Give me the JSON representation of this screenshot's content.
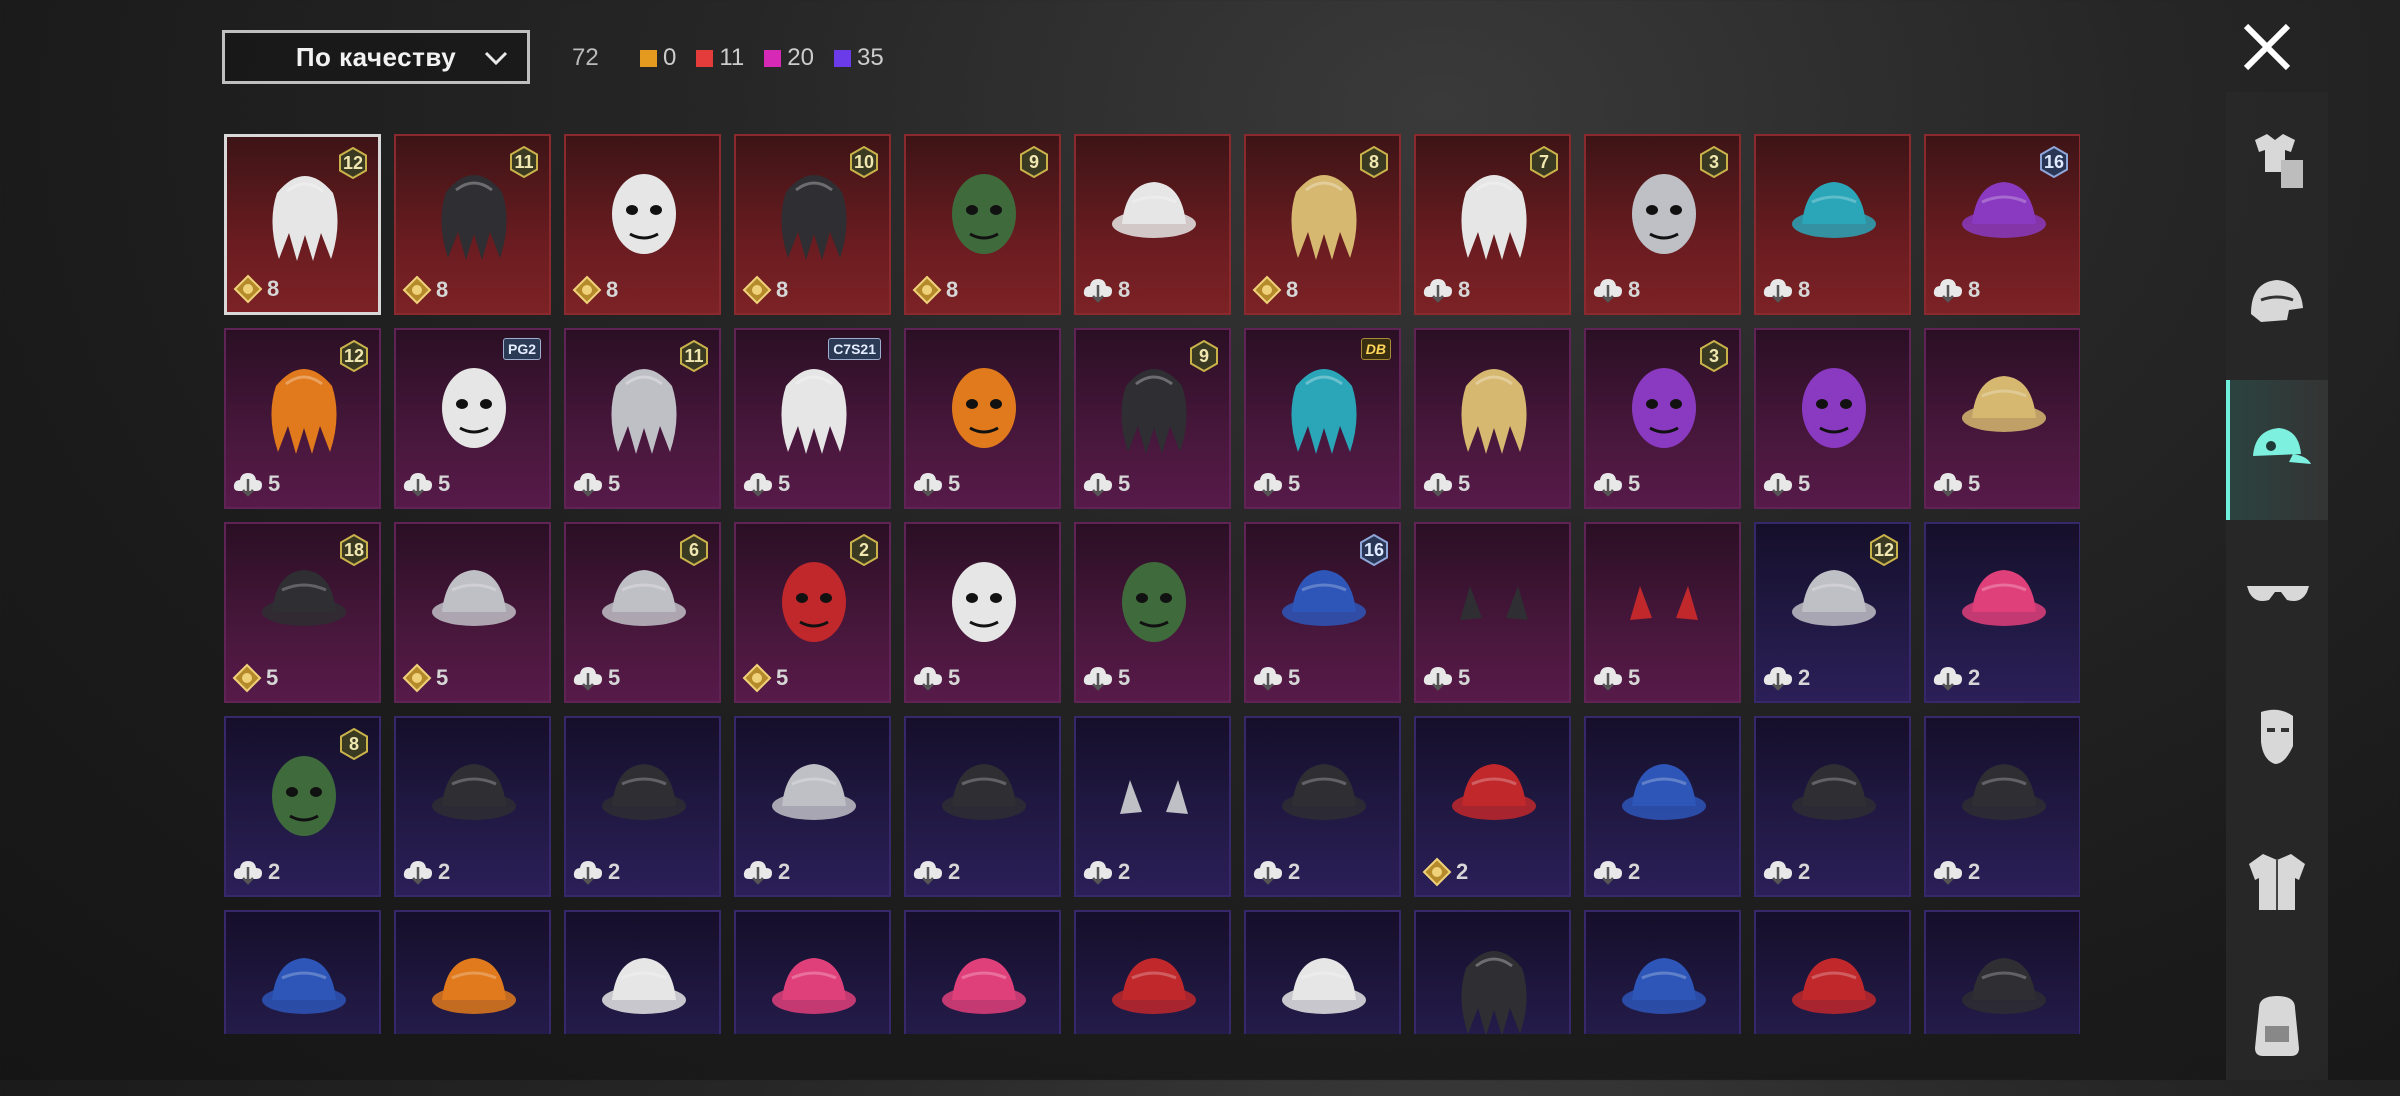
{
  "toolbar": {
    "sort_label": "По качеству",
    "total": "72",
    "counts": [
      {
        "color": "#e39a1f",
        "value": "0"
      },
      {
        "color": "#e43b3b",
        "value": "11"
      },
      {
        "color": "#d629b5",
        "value": "20"
      },
      {
        "color": "#6b3bea",
        "value": "35"
      }
    ]
  },
  "items": [
    {
      "tier": "red",
      "icon": "white-hair-ribbon-icon",
      "badge": "12",
      "currency": "gold",
      "count": "8",
      "selected": true
    },
    {
      "tier": "red",
      "icon": "black-hair-icon",
      "badge": "11",
      "currency": "gold",
      "count": "8"
    },
    {
      "tier": "red",
      "icon": "ghost-hood-icon",
      "currency": "gold",
      "count": "8"
    },
    {
      "tier": "red",
      "icon": "dark-braids-icon",
      "badge": "10",
      "currency": "gold",
      "count": "8"
    },
    {
      "tier": "red",
      "icon": "green-mask-icon",
      "badge": "9",
      "currency": "gold",
      "count": "8"
    },
    {
      "tier": "red",
      "icon": "white-cowboy-hat-icon",
      "currency": "silver",
      "count": "8"
    },
    {
      "tier": "red",
      "icon": "blonde-hair-icon",
      "badge": "8",
      "currency": "gold",
      "count": "8"
    },
    {
      "tier": "red",
      "icon": "silver-ponytail-icon",
      "badge": "7",
      "currency": "silver",
      "count": "8"
    },
    {
      "tier": "red",
      "icon": "joker-mask-icon",
      "badge": "3",
      "currency": "silver",
      "count": "8"
    },
    {
      "tier": "red",
      "icon": "teal-dragon-helmet-icon",
      "currency": "silver",
      "count": "8"
    },
    {
      "tier": "red",
      "icon": "purple-mech-helmet-icon",
      "badge": "16",
      "badge_style": "blue",
      "currency": "silver",
      "count": "8"
    },
    {
      "tier": "pink",
      "icon": "orange-hair-icon",
      "badge": "12",
      "currency": "silver",
      "count": "5"
    },
    {
      "tier": "pink",
      "icon": "panda-head-icon",
      "tag": "PG2",
      "currency": "silver",
      "count": "5"
    },
    {
      "tier": "pink",
      "icon": "flower-crown-hair-icon",
      "badge": "11",
      "currency": "silver",
      "count": "5"
    },
    {
      "tier": "pink",
      "icon": "silver-wave-hair-icon",
      "tag": "C7S21",
      "currency": "silver",
      "count": "5"
    },
    {
      "tier": "pink",
      "icon": "pumpkin-head-icon",
      "currency": "silver",
      "count": "5"
    },
    {
      "tier": "pink",
      "icon": "dark-long-hair-icon",
      "badge": "9",
      "currency": "silver",
      "count": "5"
    },
    {
      "tier": "pink",
      "icon": "blue-spiky-hair-icon",
      "tag": "DB",
      "tag_style": "gold",
      "currency": "silver",
      "count": "5"
    },
    {
      "tier": "pink",
      "icon": "blonde-curls-icon",
      "currency": "silver",
      "count": "5"
    },
    {
      "tier": "pink",
      "icon": "jester-mask-icon",
      "badge": "3",
      "currency": "silver",
      "count": "5"
    },
    {
      "tier": "pink",
      "icon": "rabbit-mask-icon",
      "currency": "silver",
      "count": "5"
    },
    {
      "tier": "pink",
      "icon": "golden-dragon-helmet-icon",
      "currency": "silver",
      "count": "5"
    },
    {
      "tier": "pink",
      "icon": "striped-top-hat-icon",
      "badge": "18",
      "currency": "gold",
      "count": "5"
    },
    {
      "tier": "pink",
      "icon": "antler-helmet-icon",
      "currency": "gold",
      "count": "5"
    },
    {
      "tier": "pink",
      "icon": "tree-hat-icon",
      "badge": "6",
      "currency": "silver",
      "count": "5"
    },
    {
      "tier": "pink",
      "icon": "predator-mask-icon",
      "badge": "2",
      "currency": "gold",
      "count": "5"
    },
    {
      "tier": "pink",
      "icon": "zebra-head-icon",
      "currency": "silver",
      "count": "5"
    },
    {
      "tier": "pink",
      "icon": "frog-cop-head-icon",
      "currency": "silver",
      "count": "5"
    },
    {
      "tier": "pink",
      "icon": "blue-visor-helmet-icon",
      "badge": "16",
      "badge_style": "blue",
      "currency": "silver",
      "count": "5"
    },
    {
      "tier": "pink",
      "icon": "dark-cat-ears-icon",
      "currency": "silver",
      "count": "5"
    },
    {
      "tier": "pink",
      "icon": "red-horns-icon",
      "currency": "silver",
      "count": "5"
    },
    {
      "tier": "violet",
      "icon": "bunny-helmet-icon",
      "badge": "12",
      "currency": "silver",
      "count": "2"
    },
    {
      "tier": "violet",
      "icon": "pink-beanie-icon",
      "currency": "silver",
      "count": "2"
    },
    {
      "tier": "violet",
      "icon": "green-skull-hood-icon",
      "badge": "8",
      "currency": "silver",
      "count": "2"
    },
    {
      "tier": "violet",
      "icon": "gas-mask-helmet-icon",
      "currency": "silver",
      "count": "2"
    },
    {
      "tier": "violet",
      "icon": "tactical-helmet-icon",
      "currency": "silver",
      "count": "2"
    },
    {
      "tier": "violet",
      "icon": "star-cap-icon",
      "currency": "silver",
      "count": "2"
    },
    {
      "tier": "violet",
      "icon": "black-cap-icon",
      "currency": "silver",
      "count": "2"
    },
    {
      "tier": "violet",
      "icon": "fox-ears-icon",
      "currency": "silver",
      "count": "2"
    },
    {
      "tier": "violet",
      "icon": "witch-hat-icon",
      "currency": "silver",
      "count": "2"
    },
    {
      "tier": "violet",
      "icon": "red-mohawk-icon",
      "currency": "gold",
      "count": "2"
    },
    {
      "tier": "violet",
      "icon": "cricket-helmet-icon",
      "currency": "silver",
      "count": "2"
    },
    {
      "tier": "violet",
      "icon": "sombrero-icon",
      "currency": "silver",
      "count": "2"
    },
    {
      "tier": "violet",
      "icon": "steampunk-hat-icon",
      "currency": "silver",
      "count": "2"
    },
    {
      "tier": "violet",
      "icon": "navy-cap-icon"
    },
    {
      "tier": "violet",
      "icon": "orange-beanie-icon"
    },
    {
      "tier": "violet",
      "icon": "straw-hat-icon"
    },
    {
      "tier": "violet",
      "icon": "pink-cap-icon"
    },
    {
      "tier": "violet",
      "icon": "pink-beret-icon"
    },
    {
      "tier": "violet",
      "icon": "football-helmet-icon"
    },
    {
      "tier": "violet",
      "icon": "feather-hat-icon"
    },
    {
      "tier": "violet",
      "icon": "black-balaclava-icon"
    },
    {
      "tier": "violet",
      "icon": "shark-hat-icon"
    },
    {
      "tier": "violet",
      "icon": "red-beret-icon"
    },
    {
      "tier": "violet",
      "icon": "top-hat-icon"
    }
  ],
  "sidebar": {
    "tabs": [
      {
        "icon": "outfit-icon",
        "active": false
      },
      {
        "icon": "helmet-icon",
        "active": false
      },
      {
        "icon": "cap-icon",
        "active": true
      },
      {
        "icon": "sunglasses-icon",
        "active": false
      },
      {
        "icon": "face-mask-icon",
        "active": false
      },
      {
        "icon": "jacket-icon",
        "active": false
      },
      {
        "icon": "backpack-icon",
        "active": false
      }
    ]
  },
  "colors": {
    "tier_red": "#6a1c20",
    "tier_pink": "#48173c",
    "tier_violet": "#221a46",
    "active_tab": "#6ff0dc"
  }
}
